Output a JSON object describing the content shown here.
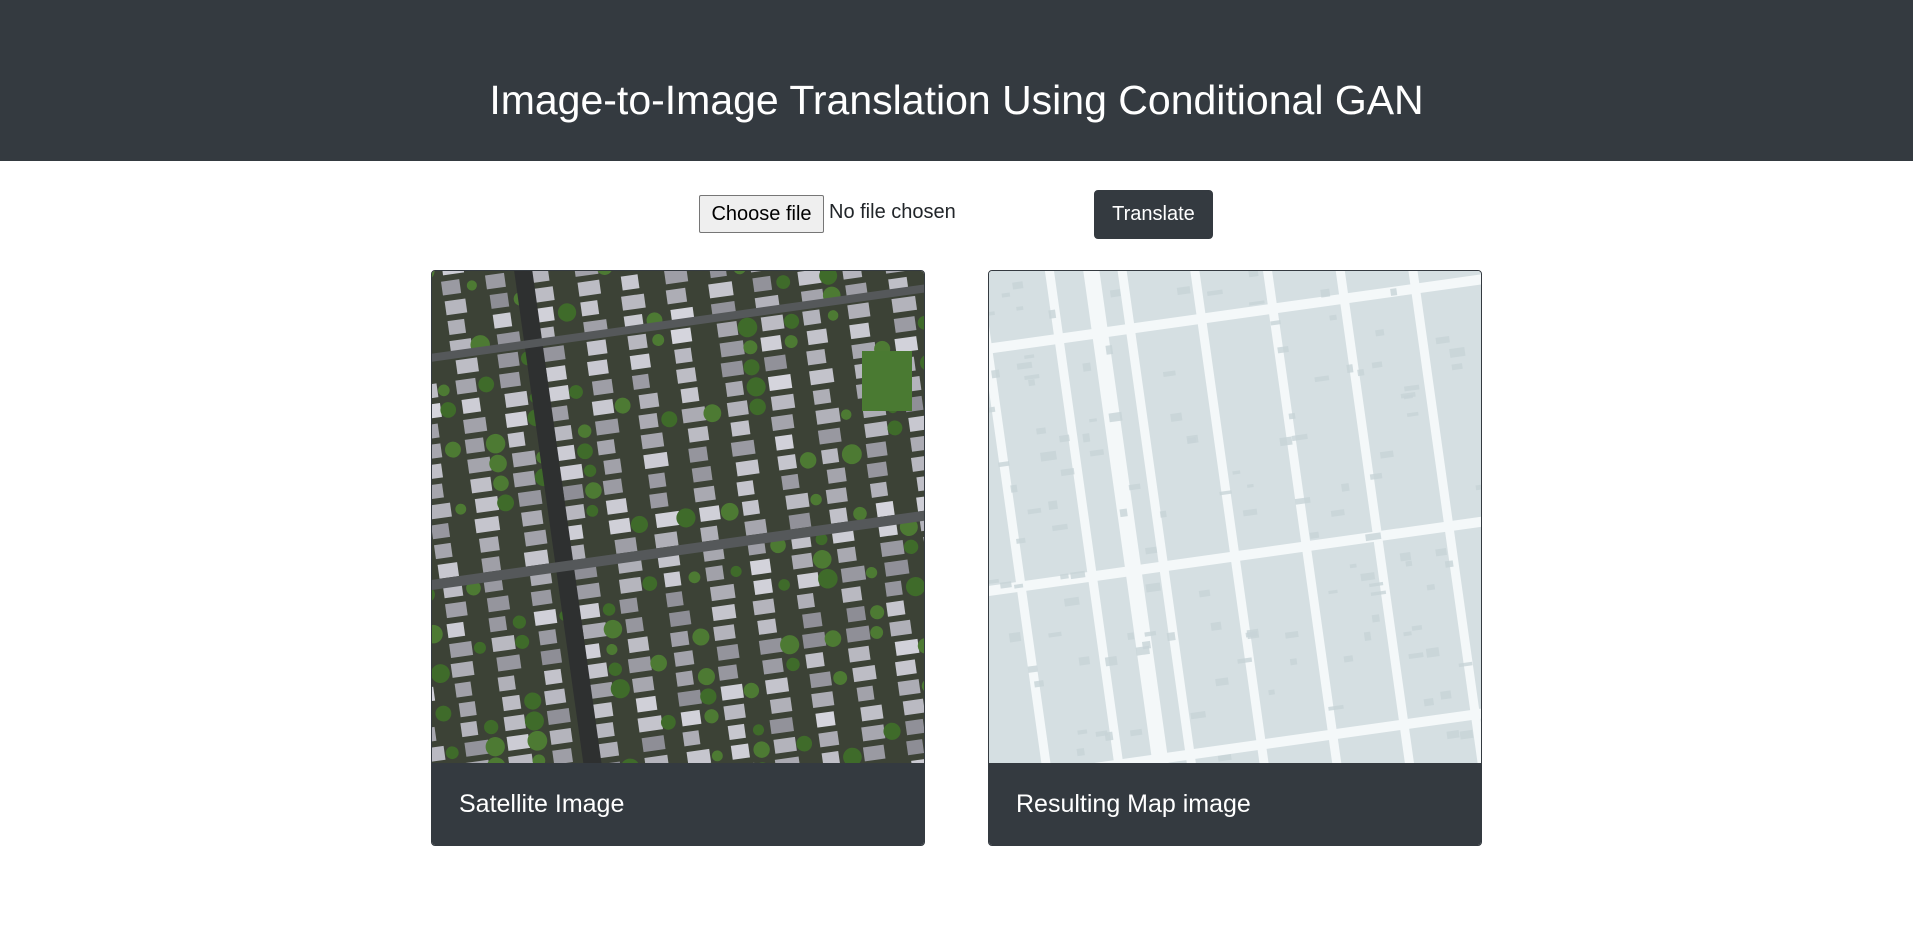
{
  "header": {
    "title": "Image-to-Image Translation Using Conditional GAN"
  },
  "upload": {
    "choose_label": "Choose file",
    "status": "No file chosen",
    "translate_label": "Translate"
  },
  "cards": [
    {
      "caption": "Satellite Image"
    },
    {
      "caption": "Resulting Map image"
    }
  ],
  "colors": {
    "dark": "#343a40",
    "map_block": "#d5dfe2",
    "map_street": "#f4f8f9"
  }
}
